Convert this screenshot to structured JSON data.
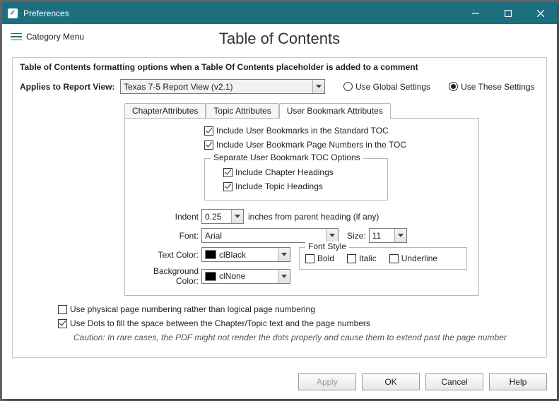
{
  "window": {
    "title": "Preferences"
  },
  "menu": {
    "category": "Category Menu"
  },
  "page": {
    "heading": "Table of Contents"
  },
  "panel": {
    "intro": "Table of Contents formatting options when a Table Of Contents placeholder is added to a comment",
    "applies_label": "Applies to Report View:",
    "applies_value": "Texas 7-5 Report View (v2.1)",
    "radio_global": "Use Global Settings",
    "radio_these": "Use These Settings",
    "radio_selected": "these"
  },
  "tabs": {
    "chapter": "ChapterAttributes",
    "topic": "Topic Attributes",
    "user": "User Bookmark Attributes",
    "active": "user"
  },
  "user_tab": {
    "include_std": "Include User Bookmarks in the Standard TOC",
    "include_std_checked": true,
    "include_pages": "Include User Bookmark Page Numbers in the TOC",
    "include_pages_checked": true,
    "separate_legend": "Separate User Bookmark TOC Options",
    "include_chapter": "Include Chapter Headings",
    "include_chapter_checked": true,
    "include_topic": "Include Topic Headings",
    "include_topic_checked": true,
    "indent_label": "Indent",
    "indent_value": "0.25",
    "indent_after": "inches from parent heading (if any)",
    "font_label": "Font:",
    "font_value": "Arial",
    "size_label": "Size:",
    "size_value": "11",
    "textcolor_label": "Text Color:",
    "textcolor_name": "clBlack",
    "textcolor_hex": "#000000",
    "bgcolor_label": "Background Color:",
    "bgcolor_name": "clNone",
    "bgcolor_hex": "#000000",
    "fontstyle_legend": "Font Style",
    "bold": "Bold",
    "bold_checked": false,
    "italic": "Italic",
    "italic_checked": false,
    "underline": "Underline",
    "underline_checked": false
  },
  "lower": {
    "physical": "Use physical page numbering rather than logical page numbering",
    "physical_checked": false,
    "dots": "Use Dots to fill the space between the Chapter/Topic text and the page numbers",
    "dots_checked": true,
    "caution": "Caution: In rare cases, the PDF might not render the dots properly and cause them to extend past the page number"
  },
  "buttons": {
    "apply": "Apply",
    "ok": "OK",
    "cancel": "Cancel",
    "help": "Help"
  }
}
